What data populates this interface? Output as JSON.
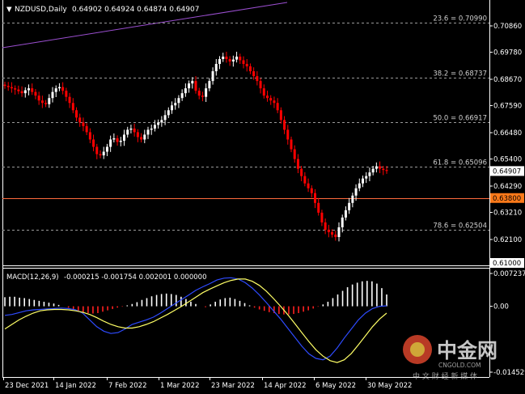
{
  "symbol_header": {
    "symbol": "NZDUSD,Daily",
    "ohlc": "0.64902 0.64924 0.64874 0.64907"
  },
  "macd_header": {
    "label": "MACD(12,26,9)",
    "values": "-0.000215 -0.001754 0.002001 0.000000"
  },
  "watermark": {
    "name_cn": "中金网",
    "site": "CNGOLD.COM",
    "subtitle_cn": "中 文 财 经 新 媒 体"
  },
  "colors": {
    "background": "#000000",
    "axis": "#ffffff",
    "bull_candle": "#ffffff",
    "bear_candle": "#ff0000",
    "fib_line": "#9a9a9a",
    "horizontal_line": "#ff6a3d",
    "trend_line": "#9b4fd0",
    "macd_line": "#2e4bff",
    "signal_line": "#ffff66",
    "hist_positive": "#ffffff",
    "hist_negative": "#ff2020",
    "price_box": "#ffffff",
    "price_box_orange": "#ff7a1a"
  },
  "chart_data": [
    {
      "type": "candlestick",
      "title": "NZDUSD,Daily",
      "price_axis_ticks": [
        0.7086,
        0.6978,
        0.6867,
        0.6759,
        0.6648,
        0.654,
        0.6429,
        0.6321,
        0.621
      ],
      "price_axis_tick_labels": [
        "0.70860",
        "0.69780",
        "0.68670",
        "0.67590",
        "0.66480",
        "0.65400",
        "0.64290",
        "0.63210",
        "0.62100"
      ],
      "ylim": [
        0.6095,
        0.7131
      ],
      "date_labels": [
        "23 Dec 2021",
        "14 Jan 2022",
        "7 Feb 2022",
        "1 Mar 2022",
        "23 Mar 2022",
        "14 Apr 2022",
        "6 May 2022",
        "30 May 2022"
      ],
      "fibonacci_levels": [
        {
          "label": "23.6 = 0.70990",
          "value": 0.7099
        },
        {
          "label": "38.2 = 0.68737",
          "value": 0.68737
        },
        {
          "label": "50.0 = 0.66917",
          "value": 0.66917
        },
        {
          "label": "61.8 = 0.65096",
          "value": 0.65096
        },
        {
          "label": "78.6 = 0.62504",
          "value": 0.62504
        }
      ],
      "horizontal_lines": [
        {
          "value": 0.638,
          "label": "0.63800"
        }
      ],
      "current_price": {
        "value": 0.64907,
        "label": "0.64907"
      },
      "bottom_price_box": {
        "value": 0.61,
        "label": "0.61000"
      },
      "closes": [
        0.684,
        0.6835,
        0.683,
        0.6825,
        0.6818,
        0.681,
        0.6822,
        0.683,
        0.6815,
        0.68,
        0.678,
        0.677,
        0.6765,
        0.679,
        0.6815,
        0.683,
        0.6835,
        0.682,
        0.6795,
        0.677,
        0.674,
        0.671,
        0.669,
        0.6675,
        0.665,
        0.662,
        0.659,
        0.656,
        0.6555,
        0.657,
        0.659,
        0.662,
        0.6625,
        0.661,
        0.6615,
        0.664,
        0.666,
        0.6665,
        0.665,
        0.663,
        0.662,
        0.664,
        0.666,
        0.6665,
        0.668,
        0.669,
        0.67,
        0.672,
        0.674,
        0.676,
        0.677,
        0.679,
        0.681,
        0.683,
        0.685,
        0.686,
        0.682,
        0.68,
        0.6795,
        0.683,
        0.686,
        0.69,
        0.693,
        0.695,
        0.696,
        0.695,
        0.694,
        0.6948,
        0.696,
        0.6945,
        0.693,
        0.692,
        0.69,
        0.688,
        0.686,
        0.683,
        0.68,
        0.679,
        0.678,
        0.677,
        0.674,
        0.67,
        0.666,
        0.662,
        0.658,
        0.654,
        0.65,
        0.647,
        0.644,
        0.642,
        0.64,
        0.636,
        0.632,
        0.628,
        0.625,
        0.624,
        0.623,
        0.622,
        0.626,
        0.63,
        0.633,
        0.636,
        0.639,
        0.642,
        0.644,
        0.646,
        0.647,
        0.6485,
        0.65,
        0.651,
        0.65,
        0.6495,
        0.6491
      ],
      "macd_panel": {
        "label": "MACD(12,26,9)",
        "axis_ticks": [
          "0.007237",
          "0.00",
          "-0.014529"
        ],
        "ylim": [
          -0.014529,
          0.007237
        ],
        "histogram": [
          0.002,
          0.0021,
          0.0021,
          0.0019,
          0.0018,
          0.0016,
          0.0014,
          0.0012,
          0.001,
          0.0008,
          0.0006,
          0.0003,
          0.0,
          -0.0003,
          -0.0007,
          -0.001,
          -0.0013,
          -0.0015,
          -0.0016,
          -0.0015,
          -0.0012,
          -0.0009,
          -0.0006,
          -0.0003,
          -0.0001,
          0.0002,
          0.0005,
          0.0009,
          0.0014,
          0.0018,
          0.0022,
          0.0025,
          0.0027,
          0.0028,
          0.0027,
          0.0025,
          0.0021,
          0.0016,
          0.001,
          0.0005,
          0.0,
          -0.0002,
          0.0004,
          0.001,
          0.0015,
          0.0018,
          0.0019,
          0.0016,
          0.0012,
          0.0007,
          0.0002,
          -0.0003,
          -0.0007,
          -0.001,
          -0.0013,
          -0.0015,
          -0.0017,
          -0.0018,
          -0.0018,
          -0.0017,
          -0.0015,
          -0.0012,
          -0.0009,
          -0.0005,
          -0.0001,
          0.0004,
          0.001,
          0.0018,
          0.0026,
          0.0034,
          0.0042,
          0.0048,
          0.0052,
          0.0055,
          0.0056,
          0.0055,
          0.005,
          0.004,
          0.0026
        ],
        "macd_line": [
          -0.002,
          -0.0018,
          -0.0014,
          -0.001,
          -0.0008,
          -0.0007,
          -0.0006,
          -0.0005,
          -0.0004,
          -0.0005,
          -0.0008,
          -0.0015,
          -0.003,
          -0.0045,
          -0.0055,
          -0.006,
          -0.0058,
          -0.005,
          -0.004,
          -0.0035,
          -0.003,
          -0.0024,
          -0.0015,
          -0.0005,
          0.0005,
          0.0015,
          0.0025,
          0.0035,
          0.0043,
          0.005,
          0.0058,
          0.0062,
          0.0063,
          0.006,
          0.0052,
          0.004,
          0.0025,
          0.0008,
          -0.001,
          -0.0028,
          -0.0048,
          -0.0068,
          -0.0088,
          -0.0105,
          -0.0115,
          -0.0118,
          -0.011,
          -0.0092,
          -0.007,
          -0.005,
          -0.003,
          -0.0015,
          -0.0005,
          0.0,
          0.0001
        ],
        "signal_line": [
          -0.005,
          -0.004,
          -0.003,
          -0.0022,
          -0.0015,
          -0.001,
          -0.0008,
          -0.0007,
          -0.0007,
          -0.0008,
          -0.001,
          -0.0013,
          -0.0018,
          -0.0025,
          -0.0033,
          -0.004,
          -0.0045,
          -0.0048,
          -0.0048,
          -0.0045,
          -0.004,
          -0.0034,
          -0.0026,
          -0.0018,
          -0.0009,
          0.0,
          0.001,
          0.002,
          0.003,
          0.0038,
          0.0045,
          0.0052,
          0.0057,
          0.006,
          0.006,
          0.0055,
          0.0046,
          0.0033,
          0.0017,
          0.0,
          -0.0018,
          -0.0038,
          -0.0058,
          -0.0078,
          -0.0096,
          -0.011,
          -0.012,
          -0.0124,
          -0.0118,
          -0.0104,
          -0.0085,
          -0.0065,
          -0.0045,
          -0.0028,
          -0.0015
        ]
      }
    }
  ]
}
